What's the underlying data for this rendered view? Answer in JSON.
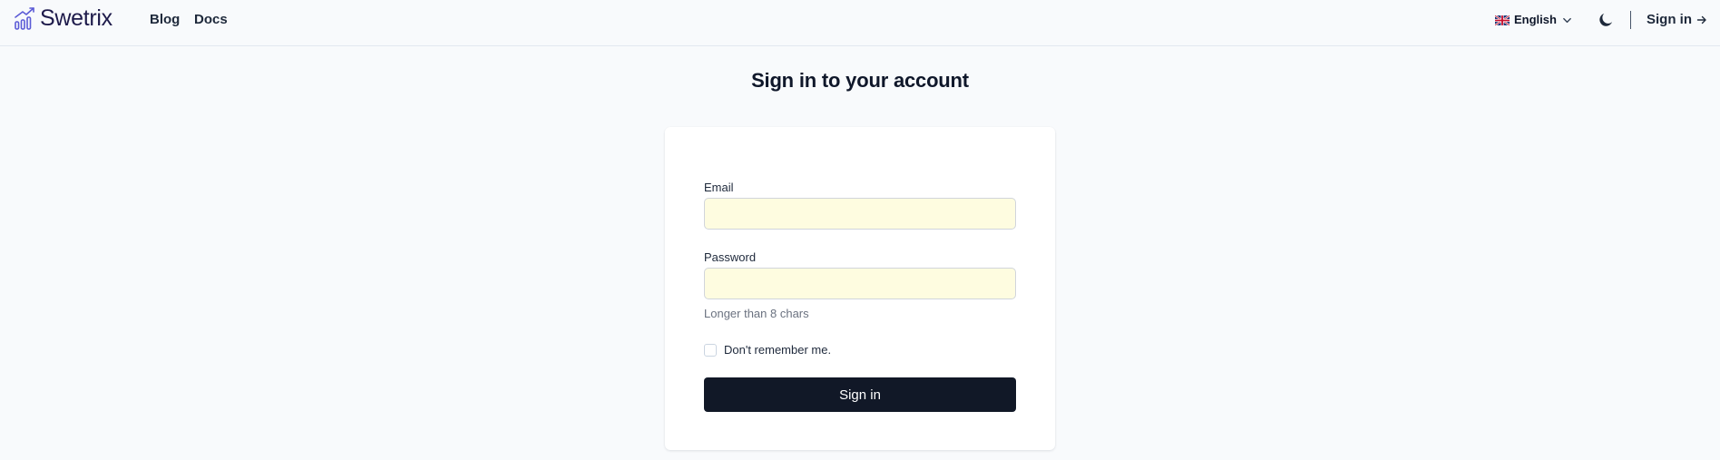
{
  "header": {
    "brand": "Swetrix",
    "nav": [
      {
        "label": "Blog"
      },
      {
        "label": "Docs"
      }
    ],
    "language": "English",
    "signin_label": "Sign in"
  },
  "page": {
    "title": "Sign in to your account"
  },
  "form": {
    "email_label": "Email",
    "email_value": "",
    "password_label": "Password",
    "password_value": "",
    "password_hint": "Longer than 8 chars",
    "remember_label": "Don't remember me.",
    "remember_checked": false,
    "submit_label": "Sign in"
  },
  "colors": {
    "brand": "#5b5bd6",
    "primary_button": "#111827",
    "autofill_bg": "#fefce0"
  },
  "icons": {
    "logo": "bar-chart-trend-icon",
    "language_flag": "uk-flag-icon",
    "language_dropdown": "chevron-down-icon",
    "theme": "moon-icon",
    "signin": "arrow-right-icon"
  }
}
